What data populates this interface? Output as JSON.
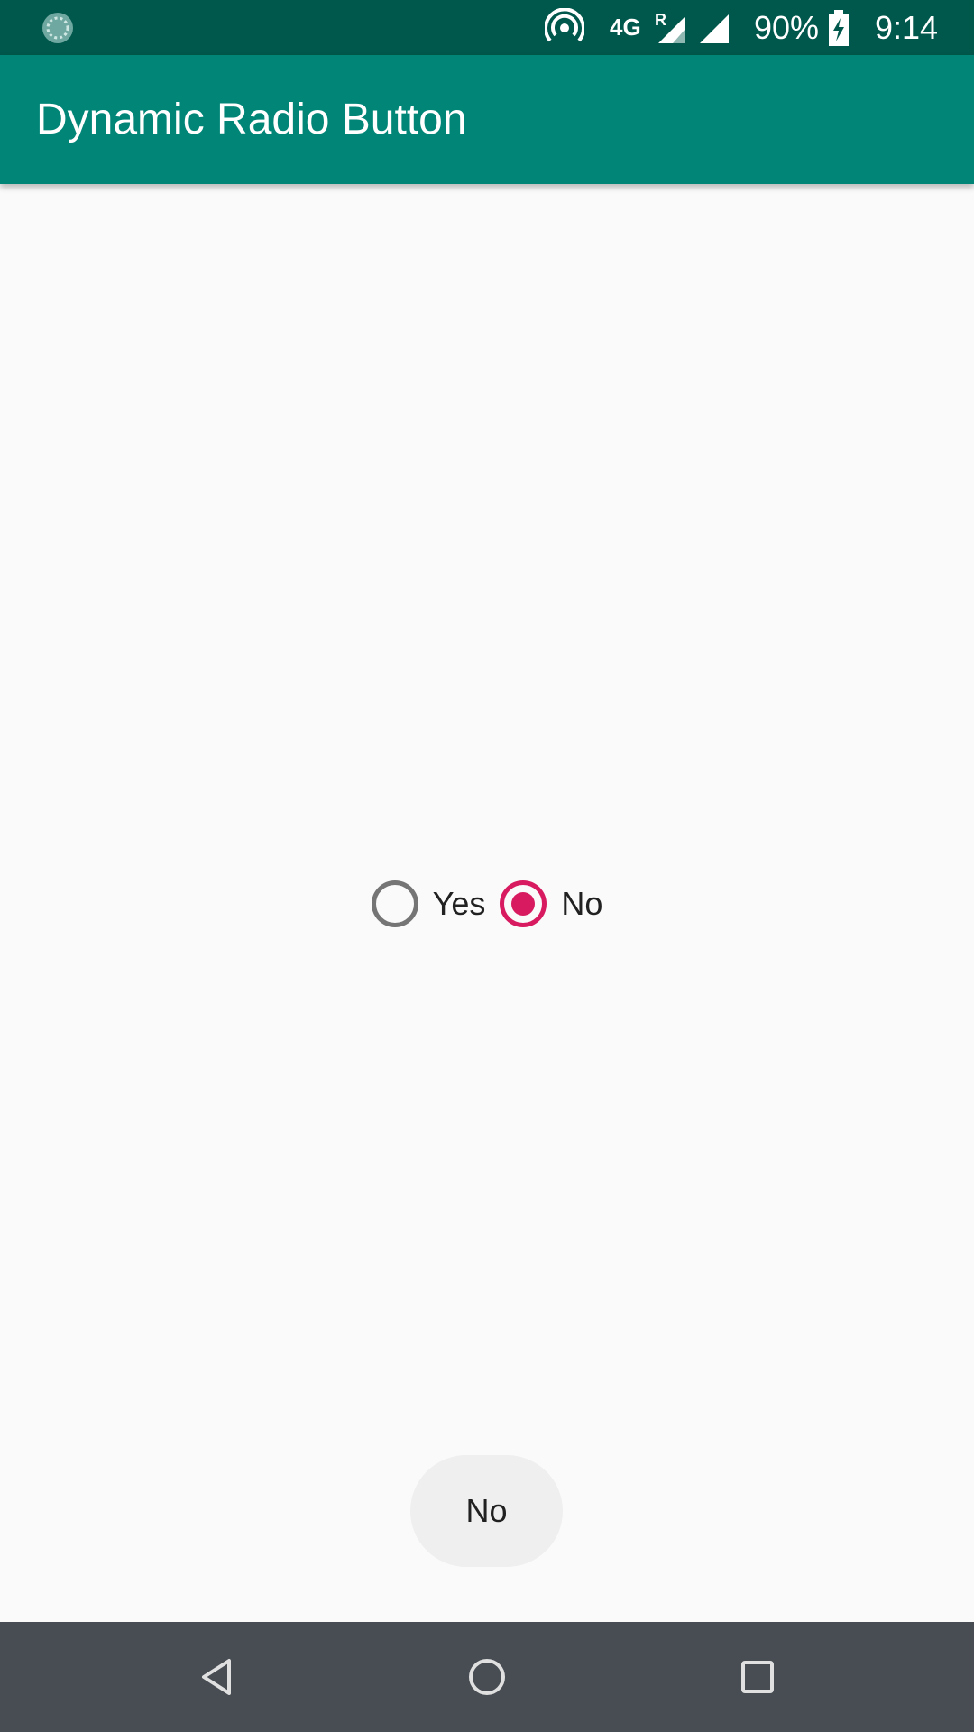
{
  "status_bar": {
    "icons": [
      "sync-icon",
      "hotspot-icon",
      "roaming-signal-icon",
      "signal-icon",
      "battery-charging-icon"
    ],
    "network_type": "4G",
    "roaming_indicator": "R",
    "battery_percent": "90%",
    "time": "9:14"
  },
  "app_bar": {
    "title": "Dynamic Radio Button",
    "color": "#008577"
  },
  "radio_group": {
    "options": [
      {
        "label": "Yes",
        "checked": false
      },
      {
        "label": "No",
        "checked": true
      }
    ],
    "accent_color": "#d81b60"
  },
  "toast": {
    "message": "No"
  },
  "nav_bar": {
    "icons": [
      "back-icon",
      "home-icon",
      "recents-icon"
    ]
  }
}
